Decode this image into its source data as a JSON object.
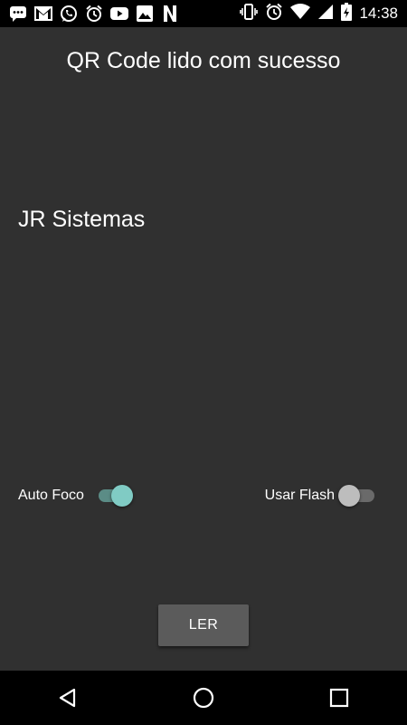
{
  "status_bar": {
    "time": "14:38",
    "left_icons": [
      "chat-icon",
      "gmail-icon",
      "whatsapp-icon",
      "alarm-icon",
      "youtube-icon",
      "photos-icon",
      "netflix-icon"
    ],
    "right_icons": [
      "vibrate-icon",
      "alarm-icon",
      "wifi-icon",
      "signal-icon",
      "battery-charging-icon"
    ]
  },
  "header": {
    "title": "QR Code lido com sucesso"
  },
  "result": {
    "text": "JR Sistemas"
  },
  "toggles": {
    "auto_focus": {
      "label": "Auto Foco",
      "enabled": true
    },
    "flash": {
      "label": "Usar Flash",
      "enabled": false
    }
  },
  "actions": {
    "read_label": "LER"
  },
  "nav_bar": {
    "buttons": [
      "back-icon",
      "home-icon",
      "recents-icon"
    ]
  },
  "colors": {
    "background": "#303030",
    "accent": "#80cbc4",
    "button": "#5b5b5b"
  }
}
